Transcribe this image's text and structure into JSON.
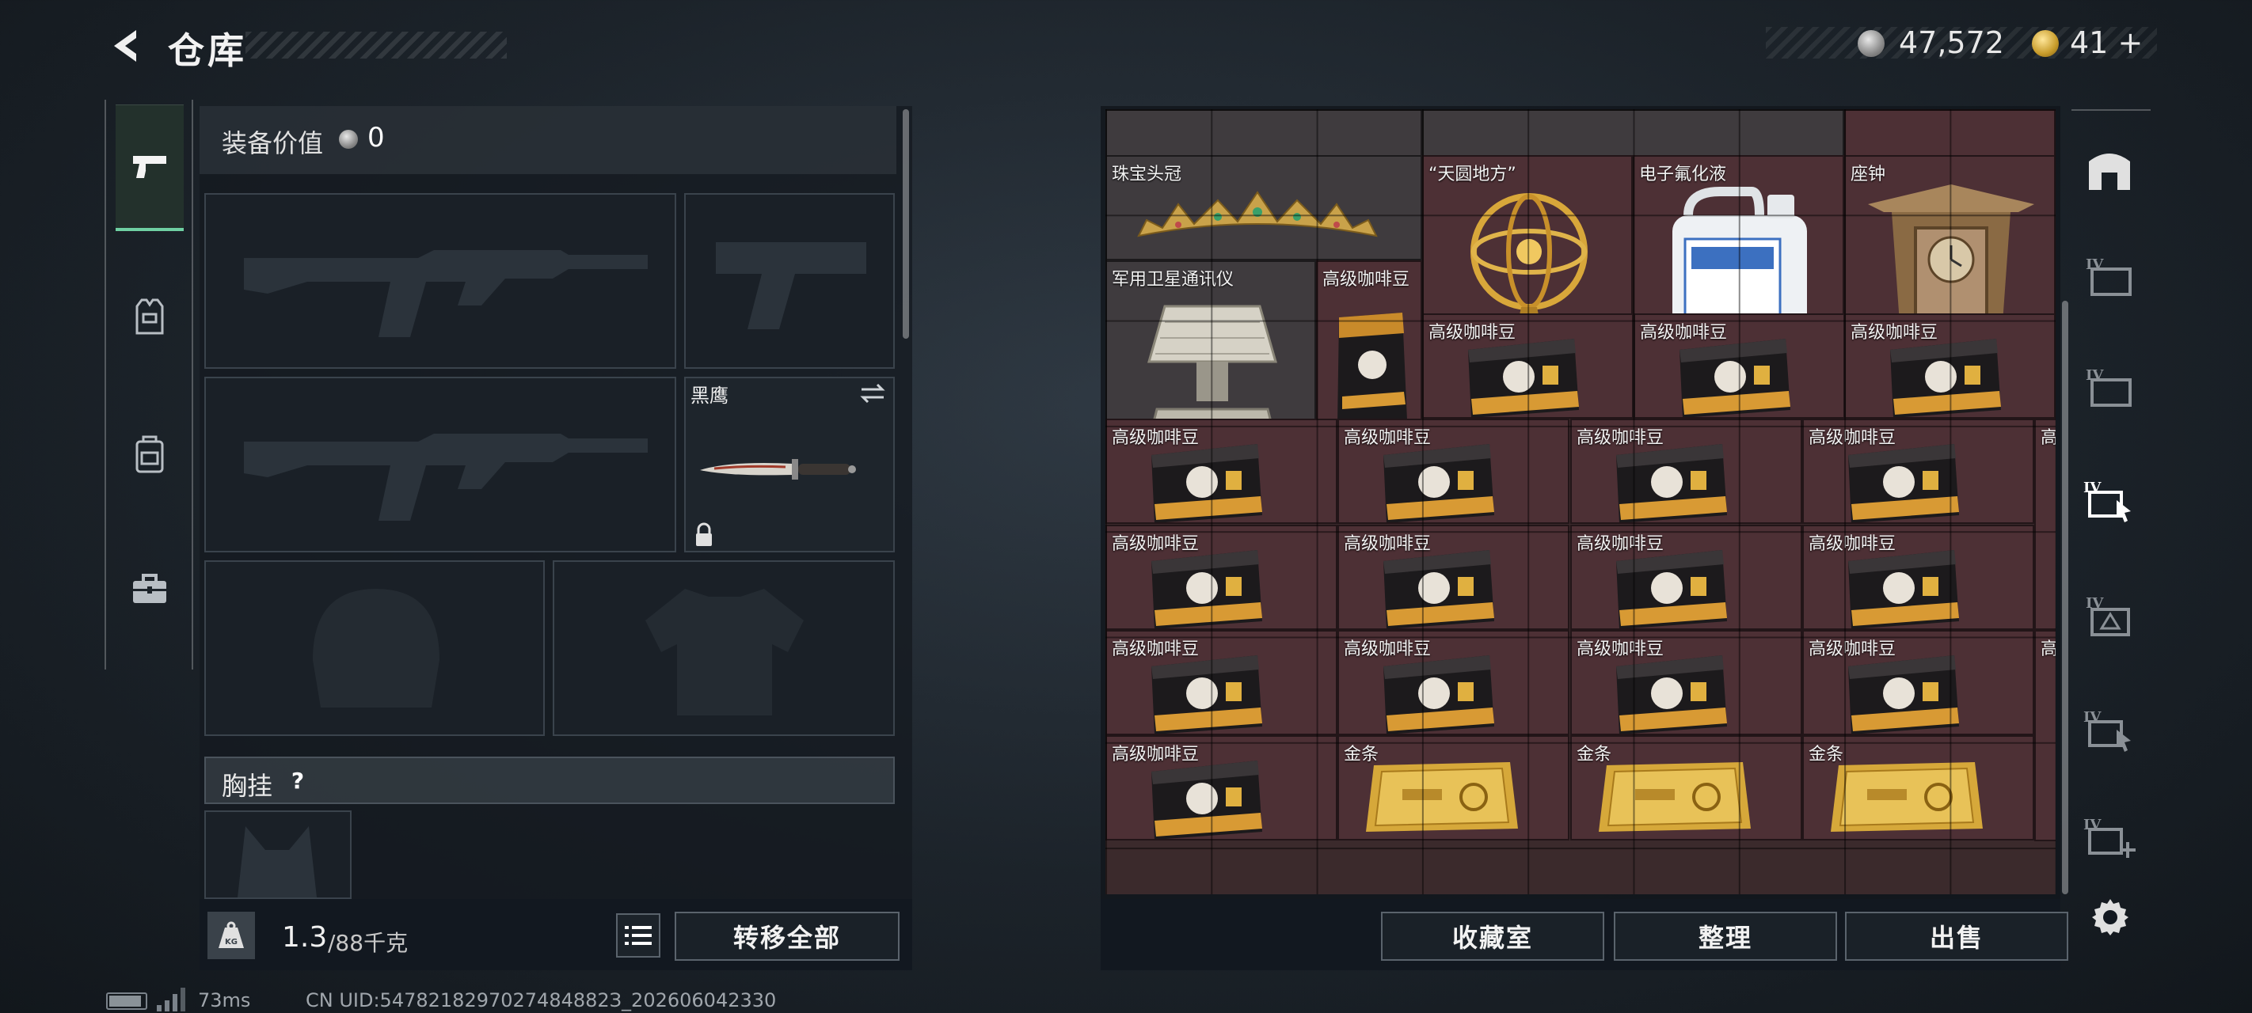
{
  "header": {
    "title": "仓库",
    "silver_amount": "47,572",
    "gold_amount": "41",
    "gold_add": "+"
  },
  "category_tabs": [
    {
      "name": "weapons",
      "icon": "pistol-icon",
      "active": true
    },
    {
      "name": "armor",
      "icon": "armor-vest-icon",
      "active": false
    },
    {
      "name": "backpack",
      "icon": "backpack-icon",
      "active": false
    },
    {
      "name": "case",
      "icon": "toolbox-icon",
      "active": false
    }
  ],
  "loadout": {
    "equip_value_label": "装备价值",
    "equip_value": "0",
    "melee_name": "黑鹰",
    "chest_rig_label": "胸挂",
    "chest_help": "?",
    "weight_current": "1.3",
    "weight_max": "/88千克",
    "weight_icon_label": "KG",
    "transfer_all": "转移全部"
  },
  "storage": {
    "items": [
      {
        "name": "珠宝头冠",
        "icon": "crown-icon"
      },
      {
        "name": "“天圆地方”",
        "icon": "armillary-sphere-icon"
      },
      {
        "name": "电子氟化液",
        "icon": "jerrycan-icon"
      },
      {
        "name": "座钟",
        "icon": "clock-icon"
      },
      {
        "name": "军用卫星通讯仪",
        "icon": "satellite-dish-icon"
      },
      {
        "name": "高级咖啡豆",
        "icon": "coffee-bag-icon"
      },
      {
        "name": "金条",
        "icon": "gold-bar-icon"
      }
    ],
    "coffee_label": "高级咖啡豆",
    "gold_label": "金条",
    "crown_label": "珠宝头冠",
    "sphere_label": "“天圆地方”",
    "fluid_label": "电子氟化液",
    "clock_label": "座钟",
    "satcom_label": "军用卫星通讯仪"
  },
  "buttons": {
    "vault": "收藏室",
    "sort": "整理",
    "sell": "出售"
  },
  "sidebar_right": [
    "building-icon",
    "iv-box-icon",
    "iv-box-icon",
    "iv-cursor-icon",
    "iv-alert-icon",
    "iv-cursor-icon",
    "iv-add-icon"
  ],
  "status": {
    "ping": "73ms",
    "uid": "CN UID:5478218297027484882З_202606042330"
  },
  "colors": {
    "active_tab": "#6fd0a3",
    "item_cell": "#4d3035",
    "grid_bg": "#3b2a2c"
  }
}
